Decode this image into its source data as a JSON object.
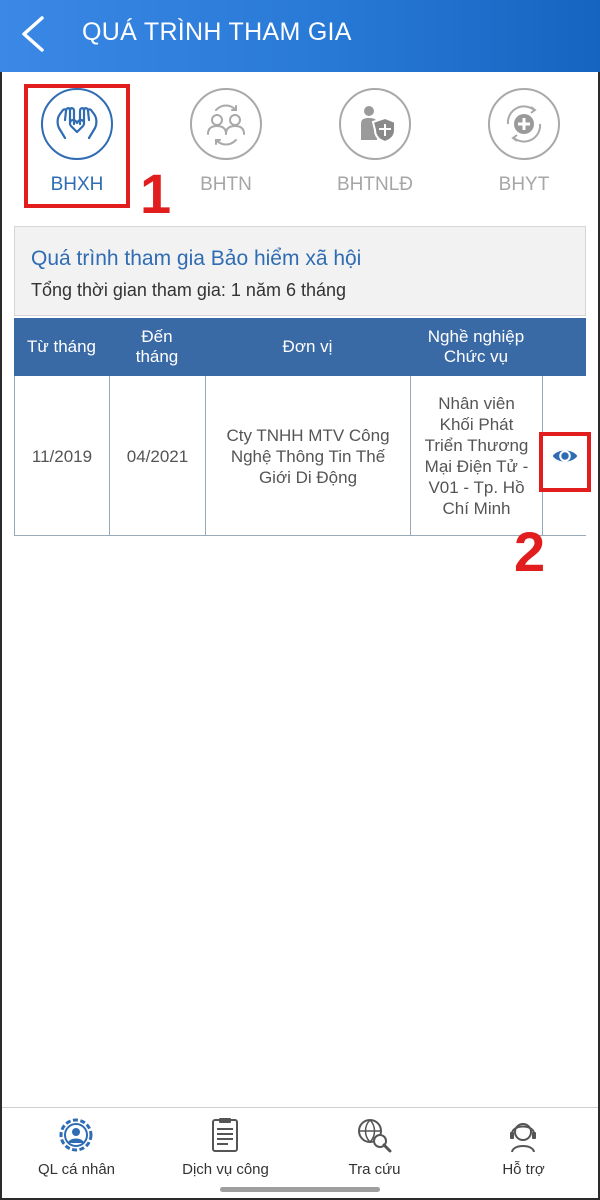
{
  "header": {
    "title": "QUÁ TRÌNH THAM GIA"
  },
  "tabs": [
    {
      "label": "BHXH",
      "icon": "hands-heart-icon",
      "active": true
    },
    {
      "label": "BHTN",
      "icon": "people-exchange-icon",
      "active": false
    },
    {
      "label": "BHTNLĐ",
      "icon": "worker-shield-icon",
      "active": false
    },
    {
      "label": "BHYT",
      "icon": "medical-cross-icon",
      "active": false
    }
  ],
  "annotations": {
    "step1": "1",
    "step2": "2"
  },
  "summary": {
    "title": "Quá trình tham gia Bảo hiểm xã hội",
    "subtitle": "Tổng thời gian tham gia: 1 năm 6 tháng"
  },
  "table": {
    "headers": {
      "from": "Từ tháng",
      "to": "Đến tháng",
      "unit": "Đơn vị",
      "job": "Nghề nghiệp Chức vụ"
    },
    "rows": [
      {
        "from": "11/2019",
        "to": "04/2021",
        "unit": "Cty TNHH MTV Công Nghệ Thông Tin Thế Giới Di Động",
        "job": "Nhân viên Khối Phát Triển Thương Mại Điện Tử - V01 - Tp. Hồ Chí Minh"
      }
    ]
  },
  "bottom_nav": [
    {
      "label": "QL cá nhân",
      "icon": "person-gear-icon"
    },
    {
      "label": "Dịch vụ công",
      "icon": "clipboard-icon"
    },
    {
      "label": "Tra cứu",
      "icon": "globe-search-icon"
    },
    {
      "label": "Hỗ trợ",
      "icon": "headset-icon"
    }
  ],
  "colors": {
    "header_start": "#3b88e6",
    "header_end": "#1565c0",
    "accent": "#2f6cb3",
    "table_header": "#3a6aa6",
    "annotation": "#e11d1d"
  }
}
